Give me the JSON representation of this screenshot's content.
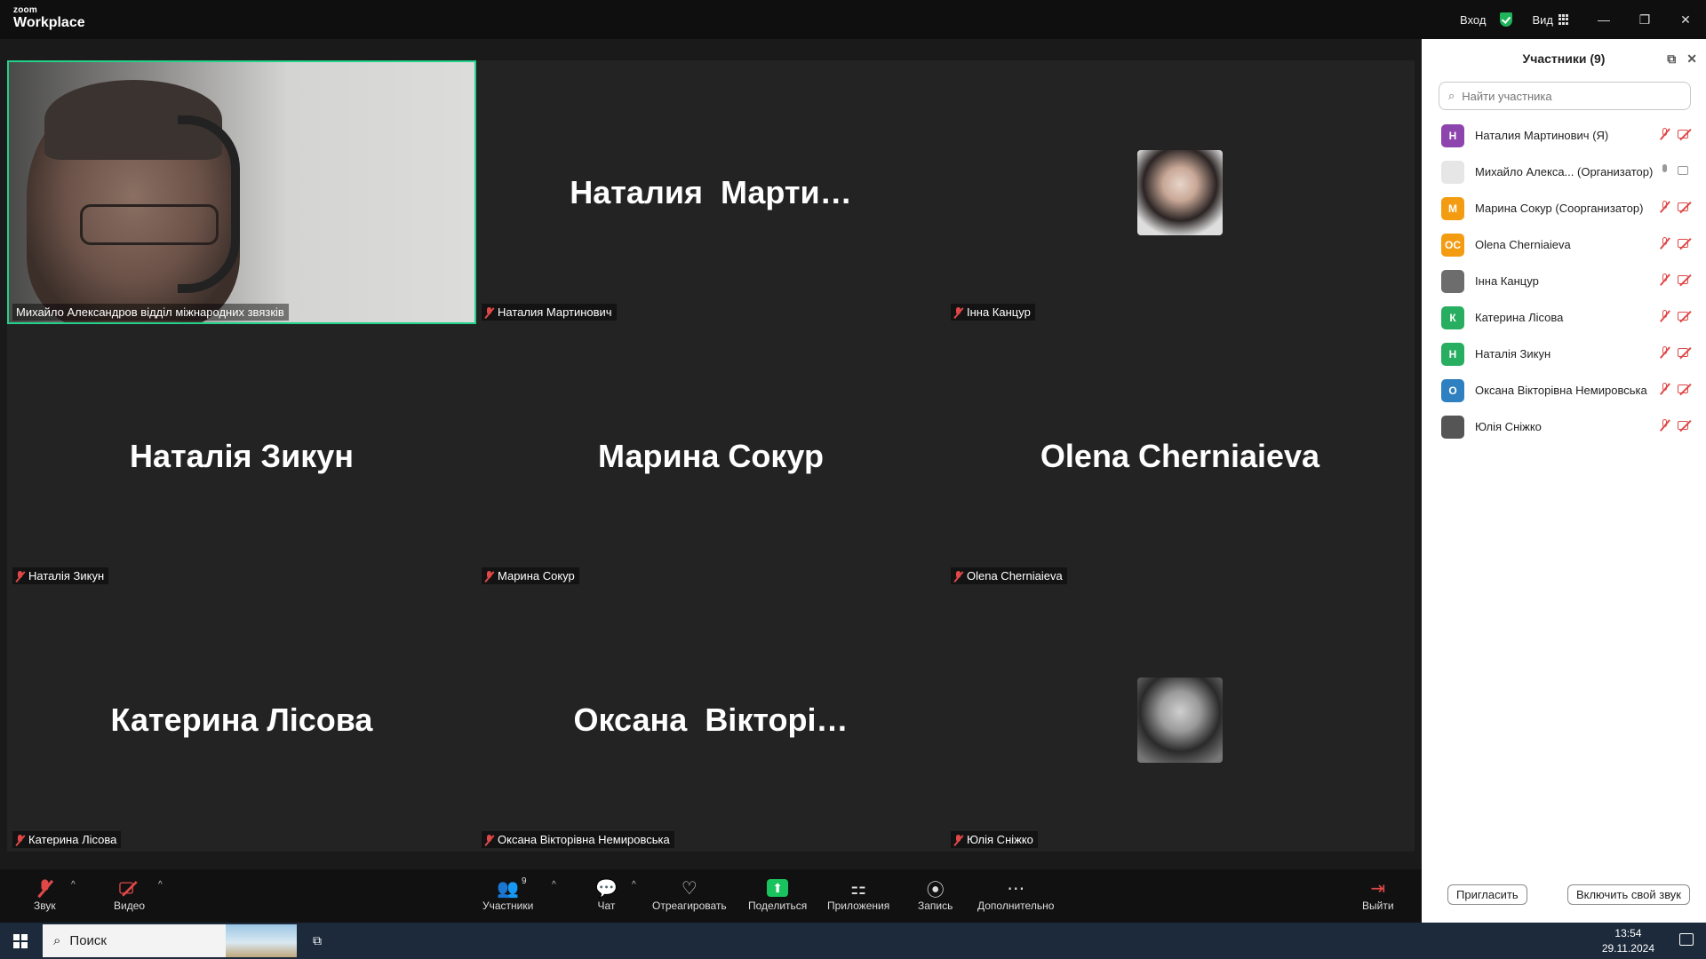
{
  "app": {
    "logo_top": "zoom",
    "logo_bottom": "Workplace"
  },
  "titlebar": {
    "signin": "Вход",
    "view": "Вид",
    "minimize": "—",
    "restore": "❐",
    "close": "✕"
  },
  "tiles": [
    {
      "kind": "video",
      "label": "Михайло Александров відділ міжнародних звязків",
      "muted": false
    },
    {
      "kind": "name",
      "big": "Наталия  Марти…",
      "label": "Наталия Мартинович",
      "muted": true
    },
    {
      "kind": "avatar",
      "label": "Інна Канцур",
      "muted": true
    },
    {
      "kind": "name",
      "big": "Наталія Зикун",
      "label": "Наталія Зикун",
      "muted": true
    },
    {
      "kind": "name",
      "big": "Марина Сокур",
      "label": "Марина Сокур",
      "muted": true
    },
    {
      "kind": "name",
      "big": "Olena Cherniaieva",
      "label": "Olena Cherniaieva",
      "muted": true
    },
    {
      "kind": "name",
      "big": "Катерина Лісова",
      "label": "Катерина Лісова",
      "muted": true
    },
    {
      "kind": "name",
      "big": "Оксана  Вікторі…",
      "label": "Оксана Вікторівна Немировська",
      "muted": true
    },
    {
      "kind": "avatar",
      "label": "Юлія Сніжко",
      "muted": true
    }
  ],
  "panel": {
    "title": "Участники (9)",
    "search_placeholder": "Найти участника",
    "participants": [
      {
        "initials": "Н",
        "color": "#8e44ad",
        "name": "Наталия Мартинович (Я)",
        "mic": "off",
        "cam": "off"
      },
      {
        "initials": "",
        "color": "#e6e6e6",
        "name": "Михайло Алекса... (Организатор)",
        "mic": "on",
        "cam": "on"
      },
      {
        "initials": "М",
        "color": "#f39c12",
        "name": "Марина Сокур (Соорганизатор)",
        "mic": "off",
        "cam": "off"
      },
      {
        "initials": "OC",
        "color": "#f39c12",
        "name": "Olena Cherniaieva",
        "mic": "off",
        "cam": "off"
      },
      {
        "initials": "",
        "color": "#6d6d6d",
        "name": "Інна Канцур",
        "mic": "off",
        "cam": "off"
      },
      {
        "initials": "К",
        "color": "#27ae60",
        "name": "Катерина Лісова",
        "mic": "off",
        "cam": "off"
      },
      {
        "initials": "Н",
        "color": "#27ae60",
        "name": "Наталія Зикун",
        "mic": "off",
        "cam": "off"
      },
      {
        "initials": "О",
        "color": "#2f80c0",
        "name": "Оксана Вікторівна Немировська",
        "mic": "off",
        "cam": "off"
      },
      {
        "initials": "",
        "color": "#555555",
        "name": "Юлія Сніжко",
        "mic": "off",
        "cam": "off"
      }
    ],
    "invite": "Пригласить",
    "enable_audio": "Включить свой звук"
  },
  "controls": {
    "audio": "Звук",
    "video": "Видео",
    "participants": "Участники",
    "participants_count": "9",
    "chat": "Чат",
    "react": "Отреагировать",
    "share": "Поделиться",
    "apps": "Приложения",
    "record": "Запись",
    "more": "Дополнительно",
    "leave": "Выйти"
  },
  "taskbar": {
    "search": "Поиск",
    "time": "13:54",
    "date": "29.11.2024"
  }
}
